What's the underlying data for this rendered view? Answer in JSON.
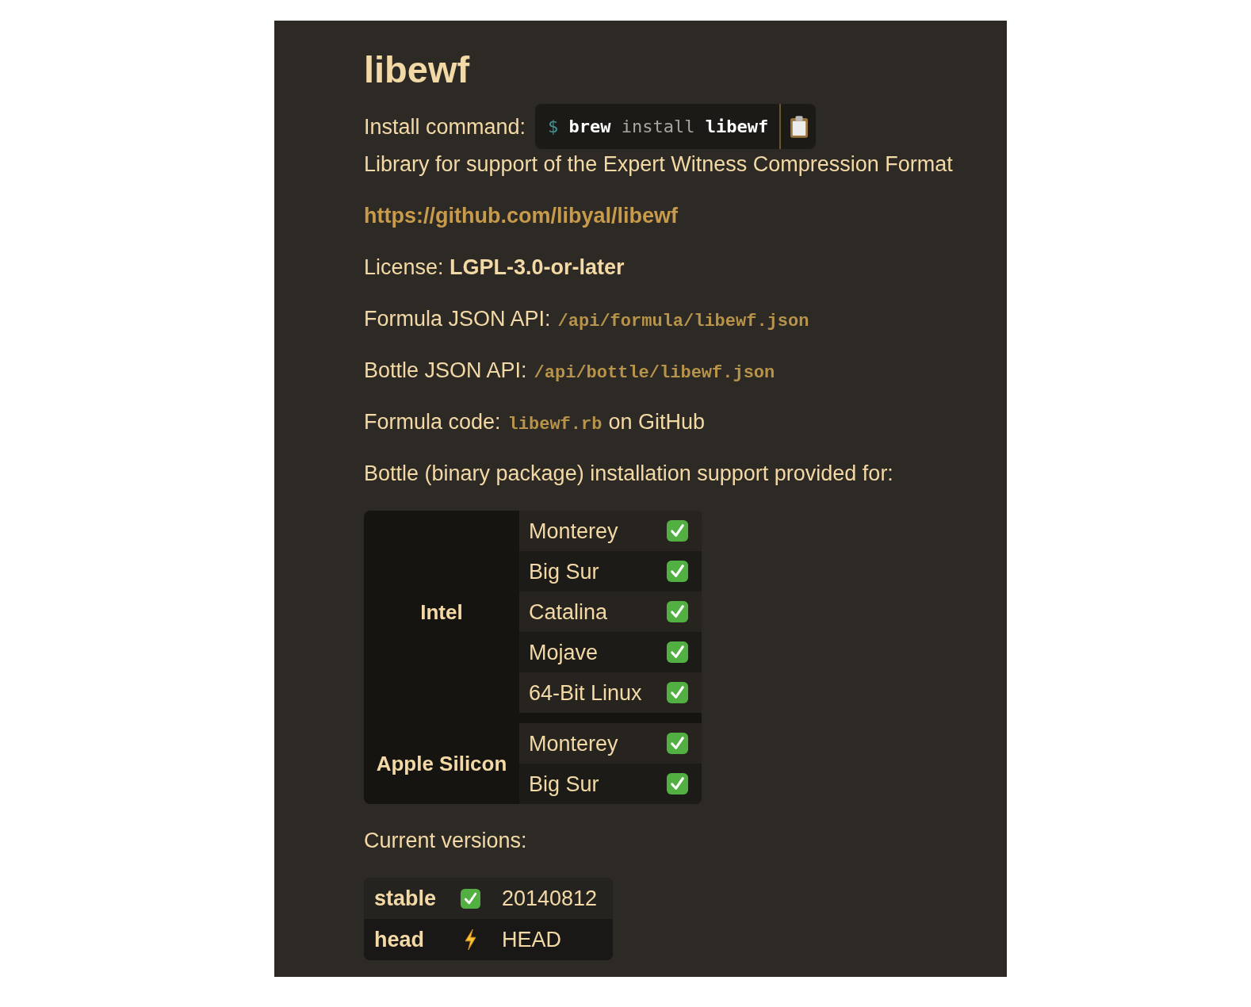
{
  "title": "libewf",
  "install": {
    "label": "Install command:",
    "tokens": [
      {
        "text": "$",
        "kind": "prompt"
      },
      {
        "text": "brew",
        "kind": "command"
      },
      {
        "text": "install",
        "kind": "argument"
      },
      {
        "text": "libewf",
        "kind": "command"
      }
    ]
  },
  "description": "Library for support of the Expert Witness Compression Format",
  "homepage_link": "https://github.com/libyal/libewf",
  "license": "License: **LGPL-3.0-or-later**",
  "api_lines": [
    {
      "label": "Formula JSON API:",
      "link": "/api/formula/libewf.json"
    },
    {
      "label": "Bottle JSON API:",
      "link": "/api/bottle/libewf.json"
    }
  ],
  "formula_code": {
    "label": "Formula code:",
    "link": "libewf.rb",
    "suffix": "on GitHub"
  },
  "bottle_heading": "Bottle (binary package) installation support provided for:",
  "bottles": [
    {
      "arch": "Intel",
      "platforms": [
        {
          "name": "Monterey",
          "checked": true
        },
        {
          "name": "Big Sur",
          "checked": true
        },
        {
          "name": "Catalina",
          "checked": true
        },
        {
          "name": "Mojave",
          "checked": true
        },
        {
          "name": "64-Bit Linux",
          "checked": true
        }
      ]
    },
    {
      "arch": "Apple Silicon",
      "platforms": [
        {
          "name": "Monterey",
          "checked": true
        },
        {
          "name": "Big Sur",
          "checked": true
        }
      ]
    }
  ],
  "versions_heading": "Current versions:",
  "versions": [
    {
      "channel": "stable",
      "kind": "check",
      "version": "20140812"
    },
    {
      "channel": "head",
      "kind": "bolt",
      "version": "HEAD"
    }
  ]
}
